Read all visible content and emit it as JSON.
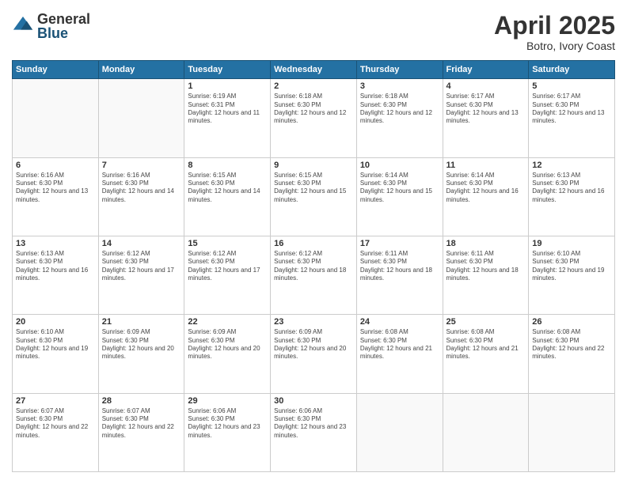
{
  "logo": {
    "general": "General",
    "blue": "Blue"
  },
  "title": "April 2025",
  "subtitle": "Botro, Ivory Coast",
  "days_header": [
    "Sunday",
    "Monday",
    "Tuesday",
    "Wednesday",
    "Thursday",
    "Friday",
    "Saturday"
  ],
  "weeks": [
    [
      {
        "day": "",
        "info": ""
      },
      {
        "day": "",
        "info": ""
      },
      {
        "day": "1",
        "info": "Sunrise: 6:19 AM\nSunset: 6:31 PM\nDaylight: 12 hours and 11 minutes."
      },
      {
        "day": "2",
        "info": "Sunrise: 6:18 AM\nSunset: 6:30 PM\nDaylight: 12 hours and 12 minutes."
      },
      {
        "day": "3",
        "info": "Sunrise: 6:18 AM\nSunset: 6:30 PM\nDaylight: 12 hours and 12 minutes."
      },
      {
        "day": "4",
        "info": "Sunrise: 6:17 AM\nSunset: 6:30 PM\nDaylight: 12 hours and 13 minutes."
      },
      {
        "day": "5",
        "info": "Sunrise: 6:17 AM\nSunset: 6:30 PM\nDaylight: 12 hours and 13 minutes."
      }
    ],
    [
      {
        "day": "6",
        "info": "Sunrise: 6:16 AM\nSunset: 6:30 PM\nDaylight: 12 hours and 13 minutes."
      },
      {
        "day": "7",
        "info": "Sunrise: 6:16 AM\nSunset: 6:30 PM\nDaylight: 12 hours and 14 minutes."
      },
      {
        "day": "8",
        "info": "Sunrise: 6:15 AM\nSunset: 6:30 PM\nDaylight: 12 hours and 14 minutes."
      },
      {
        "day": "9",
        "info": "Sunrise: 6:15 AM\nSunset: 6:30 PM\nDaylight: 12 hours and 15 minutes."
      },
      {
        "day": "10",
        "info": "Sunrise: 6:14 AM\nSunset: 6:30 PM\nDaylight: 12 hours and 15 minutes."
      },
      {
        "day": "11",
        "info": "Sunrise: 6:14 AM\nSunset: 6:30 PM\nDaylight: 12 hours and 16 minutes."
      },
      {
        "day": "12",
        "info": "Sunrise: 6:13 AM\nSunset: 6:30 PM\nDaylight: 12 hours and 16 minutes."
      }
    ],
    [
      {
        "day": "13",
        "info": "Sunrise: 6:13 AM\nSunset: 6:30 PM\nDaylight: 12 hours and 16 minutes."
      },
      {
        "day": "14",
        "info": "Sunrise: 6:12 AM\nSunset: 6:30 PM\nDaylight: 12 hours and 17 minutes."
      },
      {
        "day": "15",
        "info": "Sunrise: 6:12 AM\nSunset: 6:30 PM\nDaylight: 12 hours and 17 minutes."
      },
      {
        "day": "16",
        "info": "Sunrise: 6:12 AM\nSunset: 6:30 PM\nDaylight: 12 hours and 18 minutes."
      },
      {
        "day": "17",
        "info": "Sunrise: 6:11 AM\nSunset: 6:30 PM\nDaylight: 12 hours and 18 minutes."
      },
      {
        "day": "18",
        "info": "Sunrise: 6:11 AM\nSunset: 6:30 PM\nDaylight: 12 hours and 18 minutes."
      },
      {
        "day": "19",
        "info": "Sunrise: 6:10 AM\nSunset: 6:30 PM\nDaylight: 12 hours and 19 minutes."
      }
    ],
    [
      {
        "day": "20",
        "info": "Sunrise: 6:10 AM\nSunset: 6:30 PM\nDaylight: 12 hours and 19 minutes."
      },
      {
        "day": "21",
        "info": "Sunrise: 6:09 AM\nSunset: 6:30 PM\nDaylight: 12 hours and 20 minutes."
      },
      {
        "day": "22",
        "info": "Sunrise: 6:09 AM\nSunset: 6:30 PM\nDaylight: 12 hours and 20 minutes."
      },
      {
        "day": "23",
        "info": "Sunrise: 6:09 AM\nSunset: 6:30 PM\nDaylight: 12 hours and 20 minutes."
      },
      {
        "day": "24",
        "info": "Sunrise: 6:08 AM\nSunset: 6:30 PM\nDaylight: 12 hours and 21 minutes."
      },
      {
        "day": "25",
        "info": "Sunrise: 6:08 AM\nSunset: 6:30 PM\nDaylight: 12 hours and 21 minutes."
      },
      {
        "day": "26",
        "info": "Sunrise: 6:08 AM\nSunset: 6:30 PM\nDaylight: 12 hours and 22 minutes."
      }
    ],
    [
      {
        "day": "27",
        "info": "Sunrise: 6:07 AM\nSunset: 6:30 PM\nDaylight: 12 hours and 22 minutes."
      },
      {
        "day": "28",
        "info": "Sunrise: 6:07 AM\nSunset: 6:30 PM\nDaylight: 12 hours and 22 minutes."
      },
      {
        "day": "29",
        "info": "Sunrise: 6:06 AM\nSunset: 6:30 PM\nDaylight: 12 hours and 23 minutes."
      },
      {
        "day": "30",
        "info": "Sunrise: 6:06 AM\nSunset: 6:30 PM\nDaylight: 12 hours and 23 minutes."
      },
      {
        "day": "",
        "info": ""
      },
      {
        "day": "",
        "info": ""
      },
      {
        "day": "",
        "info": ""
      }
    ]
  ]
}
